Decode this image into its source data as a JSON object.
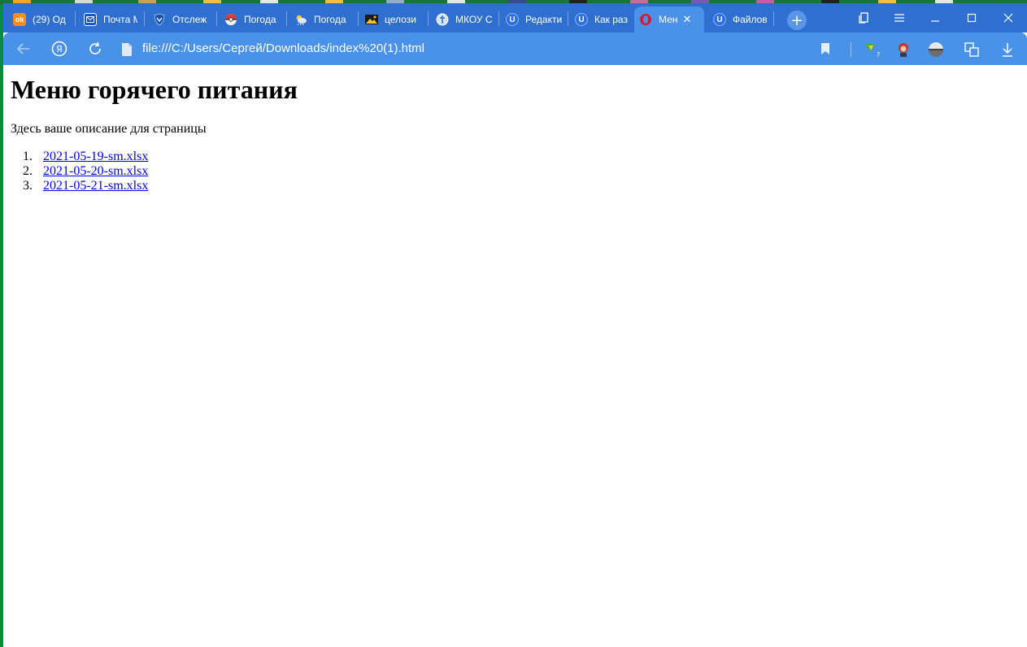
{
  "browser": {
    "tabs": [
      {
        "label": "(29) Од",
        "favicon": "odnoklassniki-icon",
        "active": false
      },
      {
        "label": "Почта М",
        "favicon": "mail-icon",
        "active": false
      },
      {
        "label": "Отслеж",
        "favicon": "tracking-shield-icon",
        "active": false
      },
      {
        "label": "Погода",
        "favicon": "pokeball-icon",
        "active": false
      },
      {
        "label": "Погода",
        "favicon": "weather-icon",
        "active": false
      },
      {
        "label": "целози",
        "favicon": "image-icon",
        "active": false
      },
      {
        "label": "МКОУ С",
        "favicon": "school-emblem-icon",
        "active": false
      },
      {
        "label": "Редакти",
        "favicon": "u-letter-icon",
        "active": false
      },
      {
        "label": "Как раз",
        "favicon": "u-letter-icon",
        "active": false
      },
      {
        "label": "Мен",
        "favicon": "opera-icon",
        "active": true
      },
      {
        "label": "Файлов",
        "favicon": "u-letter-icon",
        "active": false
      }
    ],
    "favicon_letters": {
      "odnoklassniki": "ok",
      "u": "U"
    },
    "address_bar": {
      "url": "file:///C:/Users/Сергей/Downloads/index%20(1).html"
    },
    "accent_colors": {
      "tab_strip": "#2f6fcf",
      "toolbar": "#4a92e8",
      "link": "#0000ee"
    }
  },
  "page": {
    "title": "Меню горячего питания",
    "description": "Здесь ваше описание для страницы",
    "files": [
      {
        "number": "1.",
        "name": "2021-05-19-sm.xlsx"
      },
      {
        "number": "2.",
        "name": "2021-05-20-sm.xlsx"
      },
      {
        "number": "3.",
        "name": "2021-05-21-sm.xlsx"
      }
    ]
  }
}
